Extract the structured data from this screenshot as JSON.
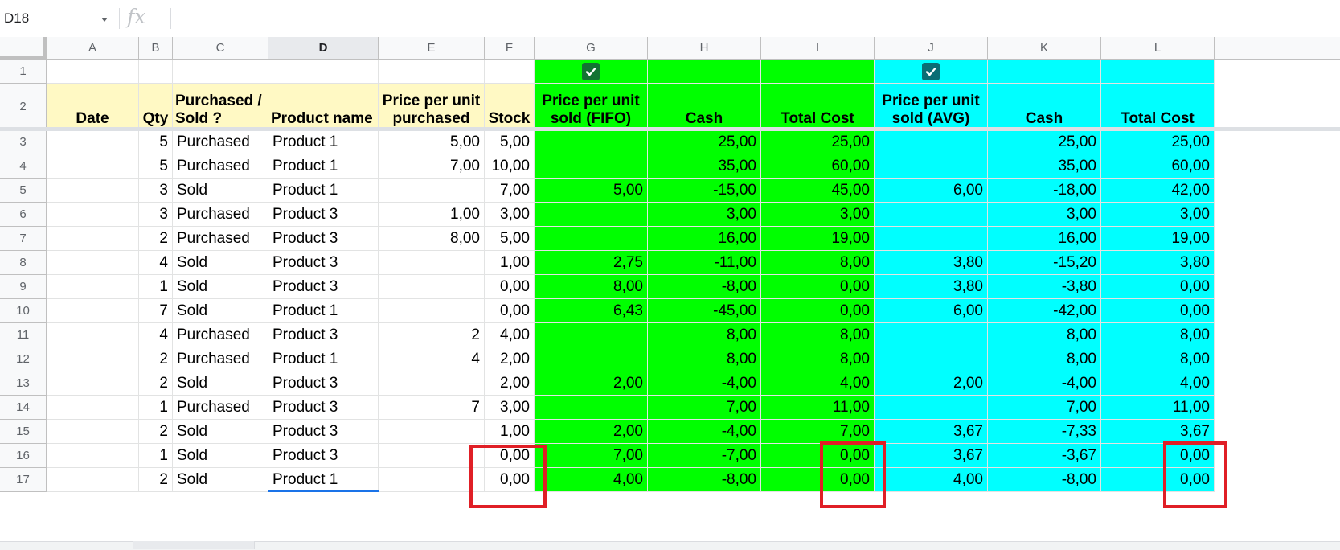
{
  "name_box": "D18",
  "fx_label": "fx",
  "columns": [
    "A",
    "B",
    "C",
    "D",
    "E",
    "F",
    "G",
    "H",
    "I",
    "J",
    "K",
    "L"
  ],
  "row_numbers": [
    "1",
    "2",
    "3",
    "4",
    "5",
    "6",
    "7",
    "8",
    "9",
    "10",
    "11",
    "12",
    "13",
    "14",
    "15",
    "16",
    "17"
  ],
  "selected_column": "D",
  "headers": {
    "date": "Date",
    "qty": "Qty",
    "purchased_sold": "Purchased / Sold ?",
    "product_name": "Product name",
    "price_purchased": "Price per unit purchased",
    "stock": "Stock",
    "price_fifo": "Price per unit sold (FIFO)",
    "cash_fifo": "Cash",
    "total_cost_fifo": "Total Cost",
    "price_avg": "Price per unit sold (AVG)",
    "cash_avg": "Cash",
    "total_cost_avg": "Total Cost"
  },
  "checkboxes": {
    "fifo": {
      "checked": true,
      "color": "#137333"
    },
    "avg": {
      "checked": true,
      "color": "#0b6e75"
    }
  },
  "colors": {
    "yellow": "#fff9c4",
    "green": "#00ff00",
    "cyan": "#00ffff",
    "highlight": "#e01f26"
  },
  "rows": [
    [
      "",
      "5",
      "Purchased",
      "Product 1",
      "5,00",
      "5,00",
      "",
      "25,00",
      "25,00",
      "",
      "25,00",
      "25,00"
    ],
    [
      "",
      "5",
      "Purchased",
      "Product 1",
      "7,00",
      "10,00",
      "",
      "35,00",
      "60,00",
      "",
      "35,00",
      "60,00"
    ],
    [
      "",
      "3",
      "Sold",
      "Product 1",
      "",
      "7,00",
      "5,00",
      "-15,00",
      "45,00",
      "6,00",
      "-18,00",
      "42,00"
    ],
    [
      "",
      "3",
      "Purchased",
      "Product 3",
      "1,00",
      "3,00",
      "",
      "3,00",
      "3,00",
      "",
      "3,00",
      "3,00"
    ],
    [
      "",
      "2",
      "Purchased",
      "Product 3",
      "8,00",
      "5,00",
      "",
      "16,00",
      "19,00",
      "",
      "16,00",
      "19,00"
    ],
    [
      "",
      "4",
      "Sold",
      "Product 3",
      "",
      "1,00",
      "2,75",
      "-11,00",
      "8,00",
      "3,80",
      "-15,20",
      "3,80"
    ],
    [
      "",
      "1",
      "Sold",
      "Product 3",
      "",
      "0,00",
      "8,00",
      "-8,00",
      "0,00",
      "3,80",
      "-3,80",
      "0,00"
    ],
    [
      "",
      "7",
      "Sold",
      "Product 1",
      "",
      "0,00",
      "6,43",
      "-45,00",
      "0,00",
      "6,00",
      "-42,00",
      "0,00"
    ],
    [
      "",
      "4",
      "Purchased",
      "Product 3",
      "2",
      "4,00",
      "",
      "8,00",
      "8,00",
      "",
      "8,00",
      "8,00"
    ],
    [
      "",
      "2",
      "Purchased",
      "Product 1",
      "4",
      "2,00",
      "",
      "8,00",
      "8,00",
      "",
      "8,00",
      "8,00"
    ],
    [
      "",
      "2",
      "Sold",
      "Product 3",
      "",
      "2,00",
      "2,00",
      "-4,00",
      "4,00",
      "2,00",
      "-4,00",
      "4,00"
    ],
    [
      "",
      "1",
      "Purchased",
      "Product 3",
      "7",
      "3,00",
      "",
      "7,00",
      "11,00",
      "",
      "7,00",
      "11,00"
    ],
    [
      "",
      "2",
      "Sold",
      "Product 3",
      "",
      "1,00",
      "2,00",
      "-4,00",
      "7,00",
      "3,67",
      "-7,33",
      "3,67"
    ],
    [
      "",
      "1",
      "Sold",
      "Product 3",
      "",
      "0,00",
      "7,00",
      "-7,00",
      "0,00",
      "3,67",
      "-3,67",
      "0,00"
    ],
    [
      "",
      "2",
      "Sold",
      "Product 1",
      "",
      "0,00",
      "4,00",
      "-8,00",
      "0,00",
      "4,00",
      "-8,00",
      "0,00"
    ]
  ]
}
